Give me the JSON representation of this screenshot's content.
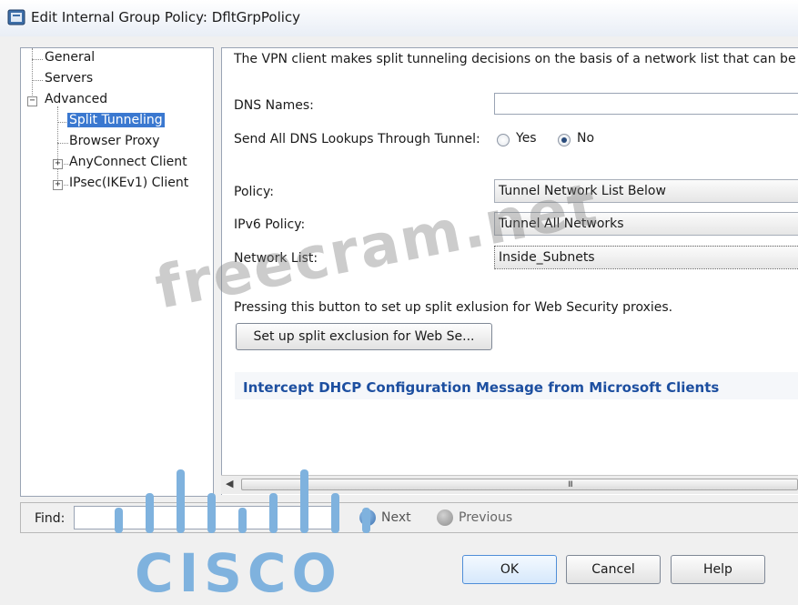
{
  "window": {
    "title": "Edit Internal Group Policy: DfltGrpPolicy"
  },
  "tree": {
    "items": [
      {
        "label": "General"
      },
      {
        "label": "Servers"
      },
      {
        "label": "Advanced"
      },
      {
        "label": "Split Tunneling"
      },
      {
        "label": "Browser Proxy"
      },
      {
        "label": "AnyConnect Client"
      },
      {
        "label": "IPsec(IKEv1) Client"
      }
    ],
    "selected": "Split Tunneling"
  },
  "split": {
    "description": "The VPN client makes split tunneling decisions on the basis of a network list that can be spec",
    "dns_names_label": "DNS Names:",
    "dns_names_value": "",
    "send_dns_label": "Send All DNS Lookups Through Tunnel:",
    "radio_yes": "Yes",
    "radio_no": "No",
    "radio_selected": "No",
    "policy_label": "Policy:",
    "policy_value": "Tunnel Network List Below",
    "ipv6_label": "IPv6 Policy:",
    "ipv6_value": "Tunnel All Networks",
    "network_list_label": "Network List:",
    "network_list_value": "Inside_Subnets",
    "exclusion_text": "Pressing this button to set up split exlusion for Web Security proxies.",
    "exclusion_button": "Set up split exclusion for Web Se...",
    "intercept_header": "Intercept DHCP Configuration Message from Microsoft Clients"
  },
  "scrollbar": {
    "grip": "III"
  },
  "find": {
    "label": "Find:",
    "value": "",
    "next": "Next",
    "previous": "Previous"
  },
  "buttons": {
    "ok": "OK",
    "cancel": "Cancel",
    "help": "Help"
  },
  "watermark": {
    "text": "freecram.net"
  },
  "logo": {
    "text": "CISCO"
  },
  "colors": {
    "selection": "#3a78d0",
    "link": "#1d4fa0",
    "cisco": "#7fb2de"
  }
}
